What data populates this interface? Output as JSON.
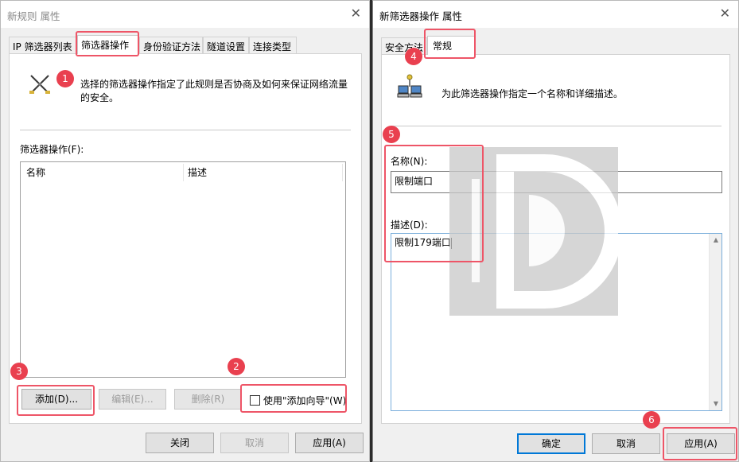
{
  "left_dialog": {
    "title": "新规则 属性",
    "tabs": [
      "IP 筛选器列表",
      "筛选器操作",
      "身份验证方法",
      "隧道设置",
      "连接类型"
    ],
    "description": "选择的筛选器操作指定了此规则是否协商及如何来保证网络流量的安全。",
    "list_label": "筛选器操作(F):",
    "columns": [
      "名称",
      "描述"
    ],
    "buttons": {
      "add": "添加(D)...",
      "edit": "编辑(E)...",
      "remove": "删除(R)"
    },
    "wizard_checkbox": "使用\"添加向导\"(W)",
    "footer": {
      "close": "关闭",
      "cancel": "取消",
      "apply": "应用(A)"
    }
  },
  "right_dialog": {
    "title": "新筛选器操作 属性",
    "tabs": [
      "安全方法",
      "常规"
    ],
    "description": "为此筛选器操作指定一个名称和详细描述。",
    "name_label": "名称(N):",
    "name_value": "限制端口",
    "desc_label": "描述(D):",
    "desc_value": "限制179端口",
    "footer": {
      "ok": "确定",
      "cancel": "取消",
      "apply": "应用(A)"
    }
  },
  "badges": [
    "1",
    "2",
    "3",
    "4",
    "5",
    "6"
  ],
  "colors": {
    "highlight": "#ee5567",
    "badge": "#e9404f",
    "accent": "#0078d7"
  }
}
